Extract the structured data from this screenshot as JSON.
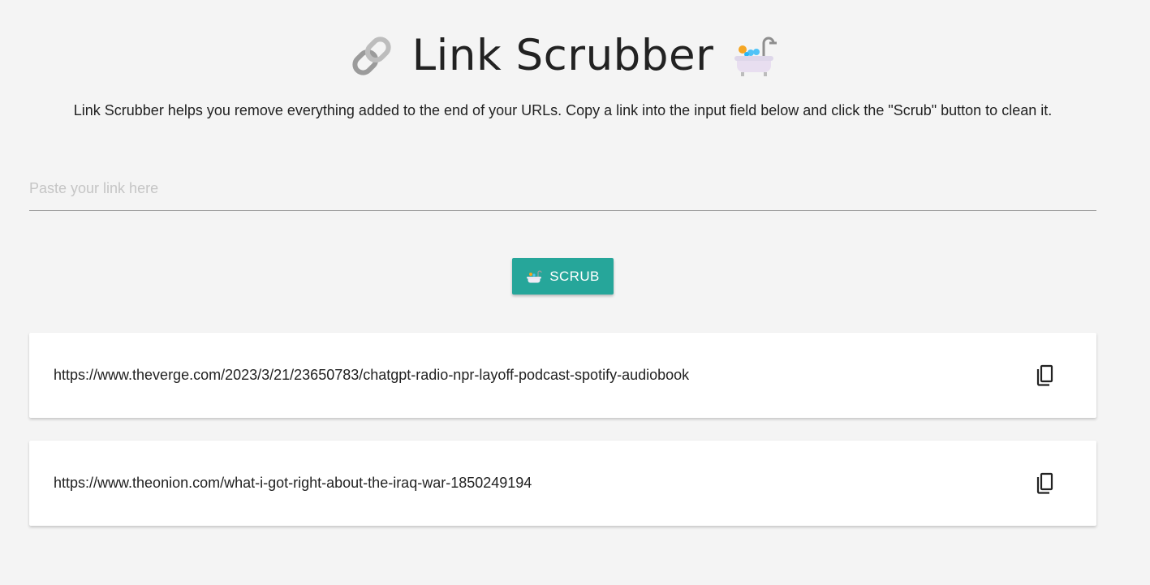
{
  "header": {
    "title": "Link Scrubber",
    "left_icon": "link-icon",
    "right_icon": "bathtub-icon"
  },
  "subtitle": "Link Scrubber helps you remove everything added to the end of your URLs. Copy a link into the input field below and click the \"Scrub\" button to clean it.",
  "input": {
    "placeholder": "Paste your link here",
    "value": ""
  },
  "scrub_button": {
    "label": "SCRUB",
    "icon": "bathtub-icon",
    "color": "#26a69a"
  },
  "results": [
    {
      "url": "https://www.theverge.com/2023/3/21/23650783/chatgpt-radio-npr-layoff-podcast-spotify-audiobook",
      "action_icon": "copy-icon"
    },
    {
      "url": "https://www.theonion.com/what-i-got-right-about-the-iraq-war-1850249194",
      "action_icon": "copy-icon"
    }
  ]
}
